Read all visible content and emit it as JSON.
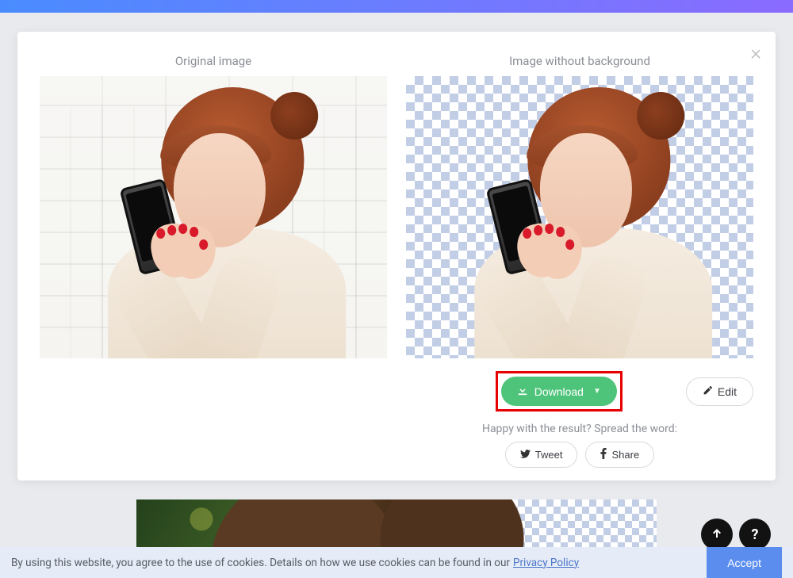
{
  "modal": {
    "left_title": "Original image",
    "right_title": "Image without background",
    "download_label": "Download",
    "edit_label": "Edit",
    "spread_text": "Happy with the result? Spread the word:",
    "tweet_label": "Tweet",
    "share_label": "Share"
  },
  "cookie": {
    "text": "By using this website, you agree to the use of cookies. Details on how we use cookies can be found in our",
    "link_label": "Privacy Policy",
    "accept_label": "Accept"
  },
  "fab": {
    "help_glyph": "?"
  }
}
